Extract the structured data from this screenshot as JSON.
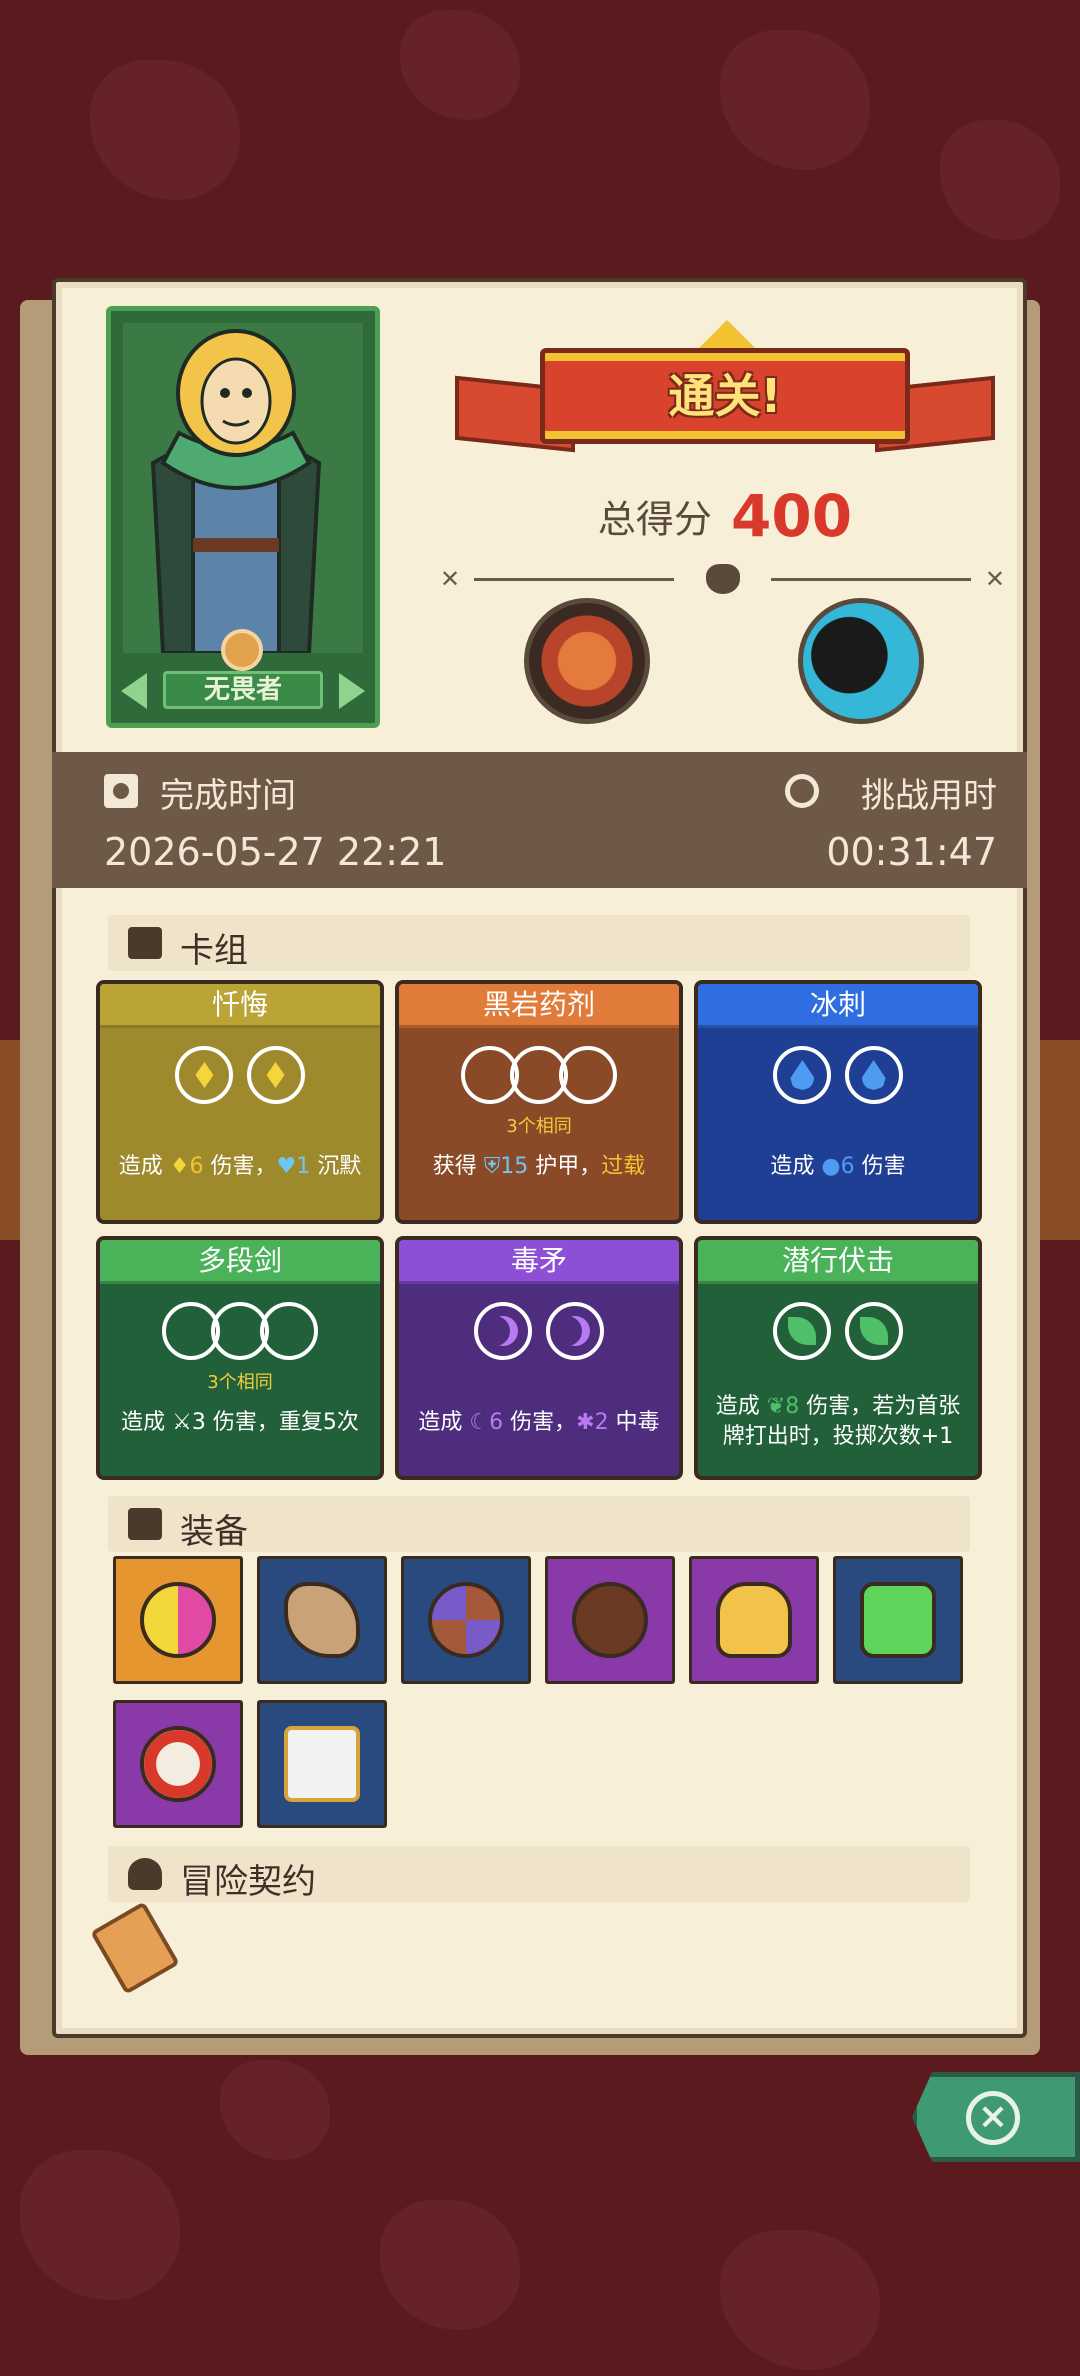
{
  "result": {
    "banner": "通关!",
    "score_label": "总得分",
    "score_value": "400"
  },
  "hero": {
    "name": "无畏者"
  },
  "bosses": [
    "eye-monster-boss",
    "shadow-beast-boss"
  ],
  "time": {
    "complete_label": "完成时间",
    "complete_value": "2026-05-27 22:21",
    "duration_label": "挑战用时",
    "duration_value": "00:31:47"
  },
  "deck": {
    "title": "卡组",
    "cards": [
      {
        "name": "忏悔",
        "color": "#b9a435",
        "orbs": 2,
        "same_label": "",
        "desc": "造成 6 伤害，1 沉默"
      },
      {
        "name": "黑岩药剂",
        "color": "#e07b3a",
        "orbs": 3,
        "same_label": "3个相同",
        "desc": "获得 15 护甲，过载"
      },
      {
        "name": "冰刺",
        "color": "#2f6ee0",
        "orbs": 2,
        "same_label": "",
        "desc": "造成 6 伤害"
      },
      {
        "name": "多段剑",
        "color": "#4ab35a",
        "orbs": 3,
        "same_label": "3个相同",
        "desc": "造成 3 伤害，重复5次"
      },
      {
        "name": "毒矛",
        "color": "#8d4fd6",
        "orbs": 2,
        "same_label": "",
        "desc": "造成 6 伤害，2 中毒"
      },
      {
        "name": "潜行伏击",
        "color": "#4ab35a",
        "orbs": 2,
        "same_label": "",
        "desc": "造成 8 伤害，若为首张牌打出时，投掷次数+1"
      }
    ],
    "desc_parts": {
      "c0_pre": "造成 ",
      "c0_n1": "6",
      "c0_mid": " 伤害，",
      "c0_n2": "1",
      "c0_post": " 沉默",
      "c1_pre": "获得 ",
      "c1_n1": "15",
      "c1_mid": " 护甲，",
      "c1_kw": "过载",
      "c2_pre": "造成 ",
      "c2_n1": "6",
      "c2_post": " 伤害",
      "c3_pre": "造成 ",
      "c3_n1": "3",
      "c3_post": " 伤害，重复5次",
      "c4_pre": "造成 ",
      "c4_n1": "6",
      "c4_mid": " 伤害，",
      "c4_n2": "2",
      "c4_post": " 中毒",
      "c5_pre": "造成 ",
      "c5_n1": "8",
      "c5_post": " 伤害，若为首张牌打出时，投掷次数+1"
    }
  },
  "equipment": {
    "title": "装备",
    "items": [
      {
        "icon": "yin-yang-orb-icon",
        "bg": "#e6962e"
      },
      {
        "icon": "horn-icon",
        "bg": "#294a7e"
      },
      {
        "icon": "shuriken-shield-icon",
        "bg": "#294a7e"
      },
      {
        "icon": "button-icon",
        "bg": "#8a3aa8"
      },
      {
        "icon": "glove-icon",
        "bg": "#8a3aa8"
      },
      {
        "icon": "emerald-icon",
        "bg": "#294a7e"
      },
      {
        "icon": "tribal-mask-icon",
        "bg": "#8a3aa8"
      },
      {
        "icon": "dice-box-icon",
        "bg": "#294a7e"
      }
    ]
  },
  "contract": {
    "title": "冒险契约",
    "icon": "scroll-icon"
  },
  "close": {
    "icon": "close-icon",
    "glyph": "×"
  }
}
